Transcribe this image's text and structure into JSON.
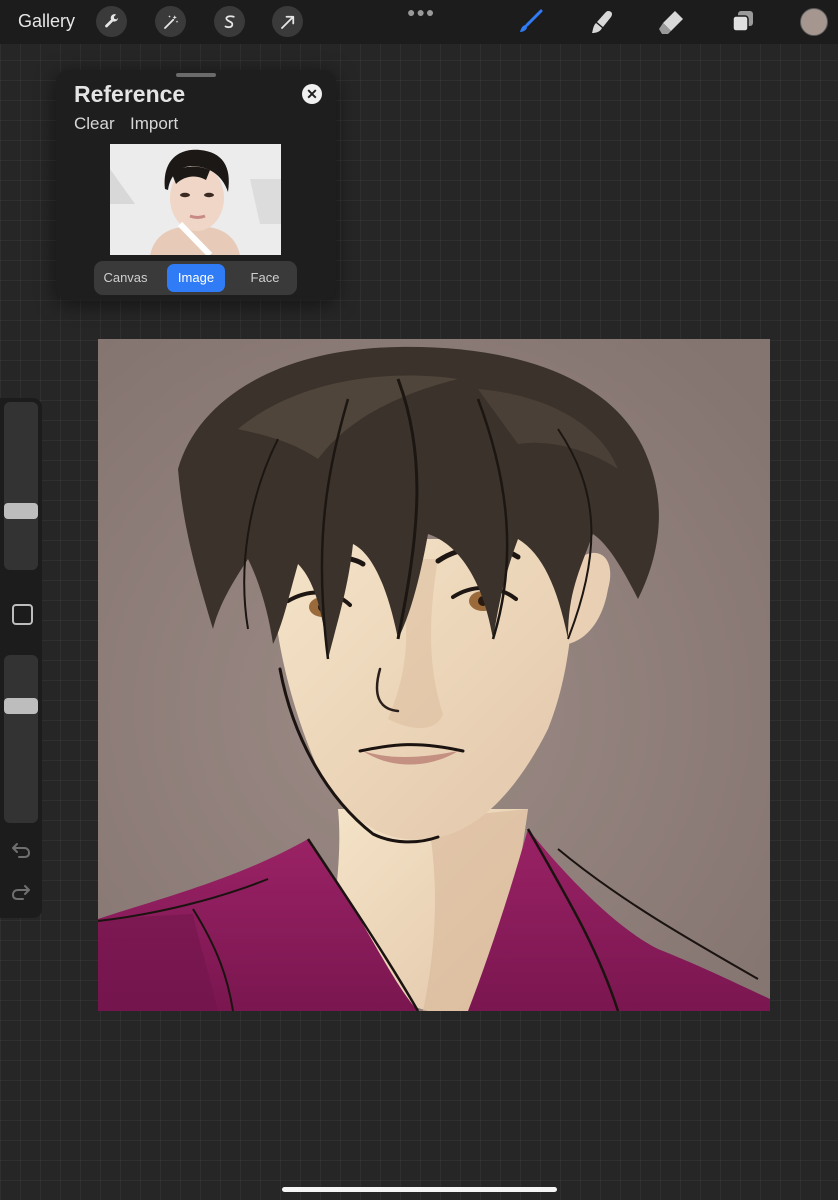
{
  "topbar": {
    "gallery_label": "Gallery",
    "left_tools": [
      "wrench-icon",
      "magic-wand-icon",
      "selection-icon",
      "transform-arrow-icon"
    ],
    "right_tools": [
      "brush-icon",
      "smudge-icon",
      "eraser-icon",
      "layers-icon"
    ],
    "active_tool": "brush-icon",
    "current_color": "#a59690",
    "accent": "#2f7cf6"
  },
  "reference": {
    "title": "Reference",
    "clear_label": "Clear",
    "import_label": "Import",
    "tabs": [
      {
        "label": "Canvas",
        "active": false
      },
      {
        "label": "Image",
        "active": true
      },
      {
        "label": "Face",
        "active": false
      }
    ]
  },
  "sidebar": {
    "brush_size_level": 0.6,
    "opacity_level": 0.71
  },
  "canvas": {
    "background_color": "#8f807a",
    "shirt_color": "#8b1c5a"
  }
}
